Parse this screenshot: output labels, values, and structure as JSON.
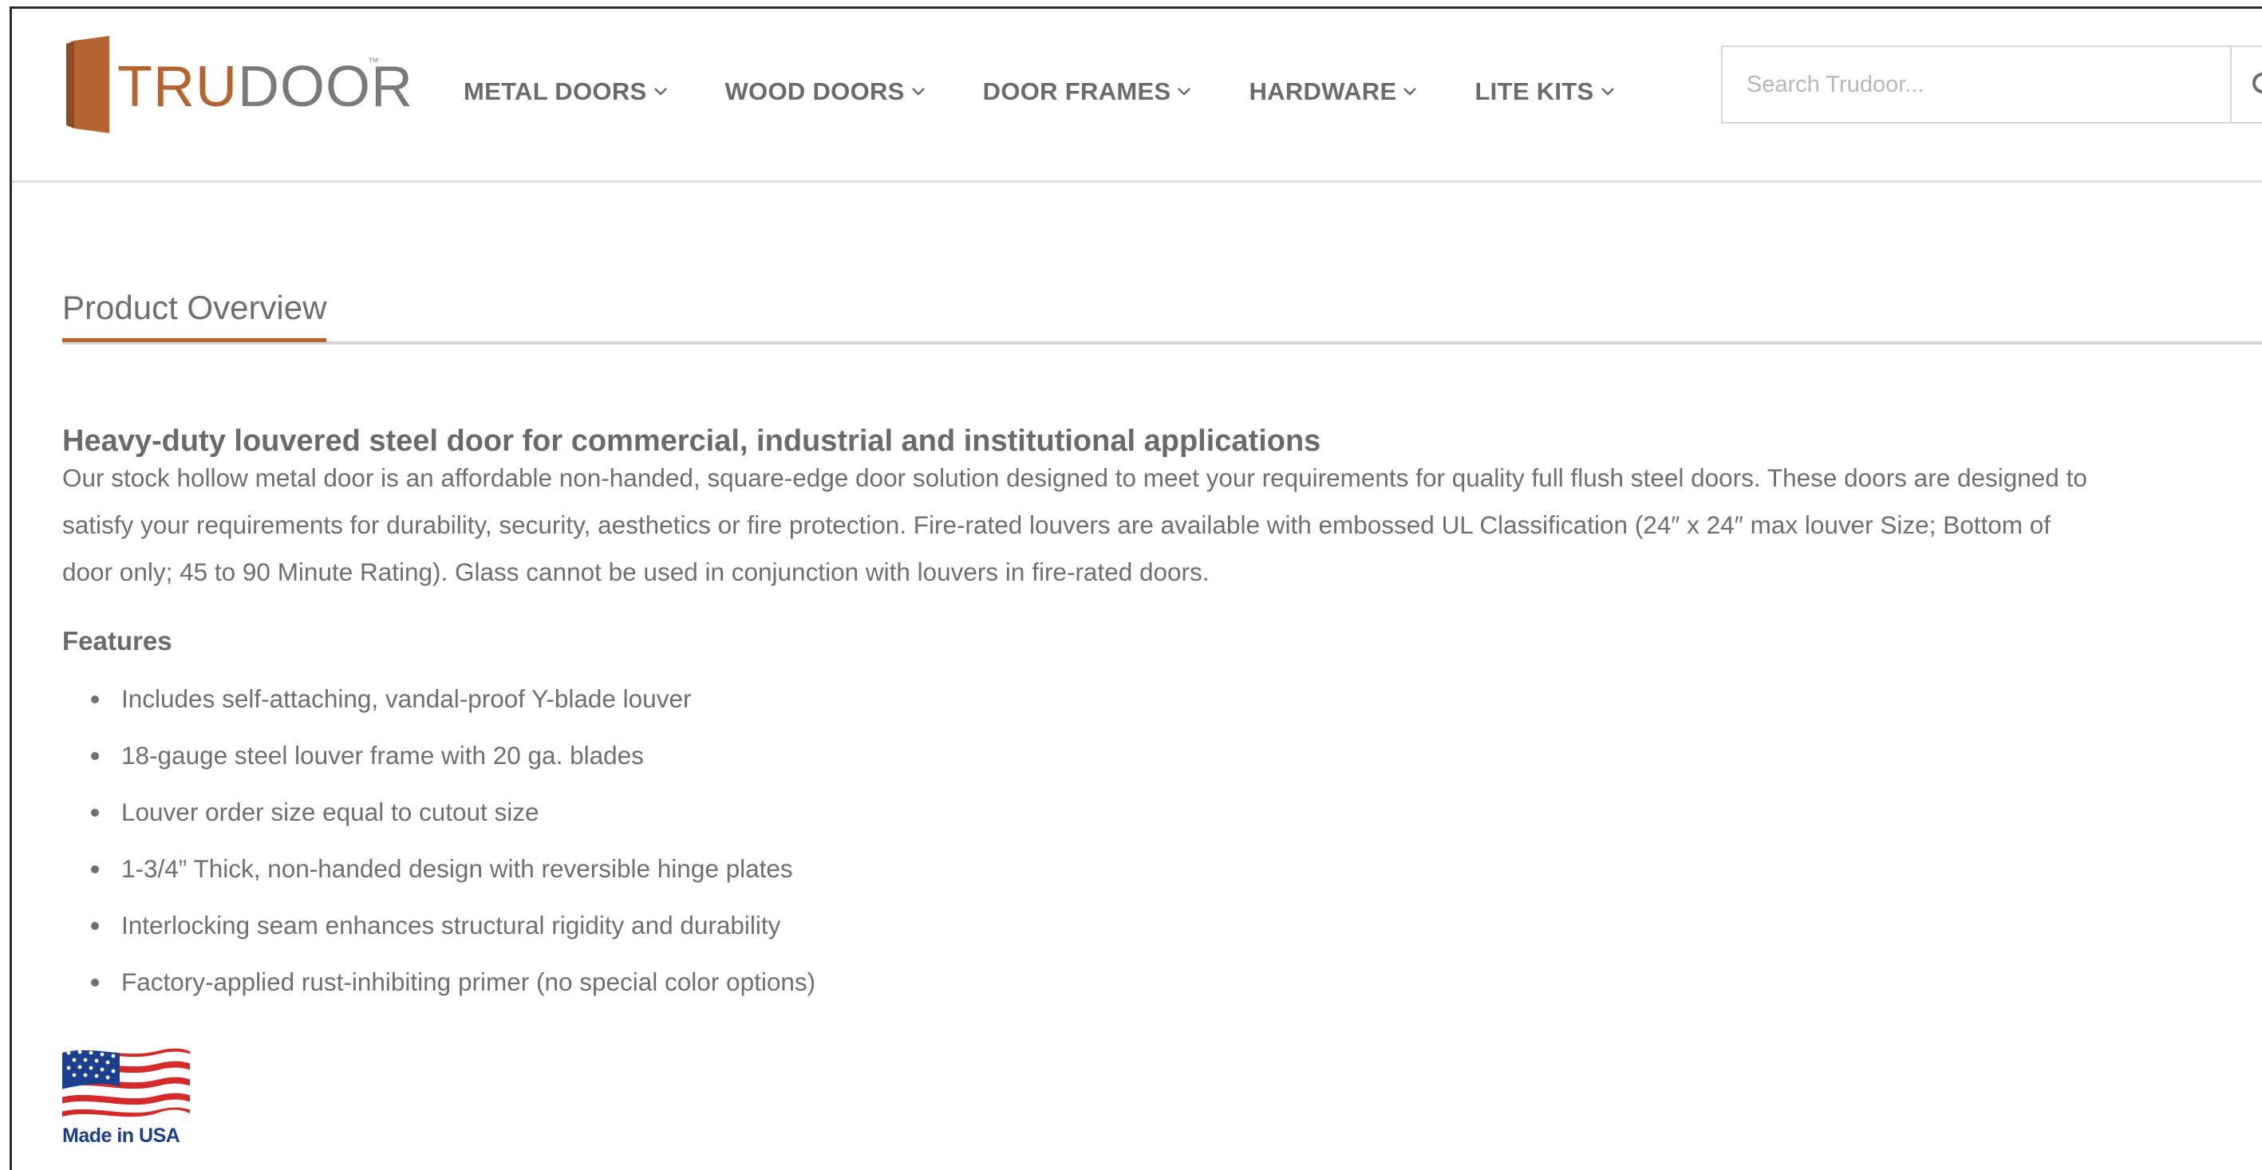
{
  "brand": {
    "logo_part1": "TRU",
    "logo_part2": "DOOR",
    "trademark": "™",
    "accent_color": "#b5632f"
  },
  "nav": {
    "items": [
      {
        "label": "METAL DOORS",
        "icon": "chevron-down-icon"
      },
      {
        "label": "WOOD DOORS",
        "icon": "chevron-down-icon"
      },
      {
        "label": "DOOR FRAMES",
        "icon": "chevron-down-icon"
      },
      {
        "label": "HARDWARE",
        "icon": "chevron-down-icon"
      },
      {
        "label": "LITE KITS",
        "icon": "chevron-down-icon"
      }
    ]
  },
  "search": {
    "placeholder": "Search Trudoor...",
    "value": "",
    "icon": "search-icon"
  },
  "content": {
    "tab_title": "Product Overview",
    "headline": "Heavy-duty louvered steel door for commercial, industrial and institutional applications",
    "description_lines": [
      "Our stock hollow metal door is an affordable non-handed, square-edge door solution designed to meet your requirements for quality full flush steel doors. These doors are designed to",
      "satisfy your requirements for durability, security, aesthetics or fire protection. Fire-rated louvers are available with embossed UL Classification (24″ x 24″ max louver Size; Bottom of",
      "door only; 45 to 90 Minute Rating). Glass cannot be used in conjunction with louvers in fire-rated doors."
    ],
    "features_title": "Features",
    "features": [
      "Includes self-attaching, vandal-proof Y-blade louver",
      "18-gauge steel louver frame with 20 ga. blades",
      "Louver order size equal to cutout size",
      "1-3/4” Thick, non-handed design with reversible hinge plates",
      "Interlocking seam enhances structural rigidity and durability",
      "Factory-applied rust-inhibiting primer (no special color options)"
    ],
    "badge_caption": "Made in USA",
    "badge_icon": "us-flag-icon"
  }
}
